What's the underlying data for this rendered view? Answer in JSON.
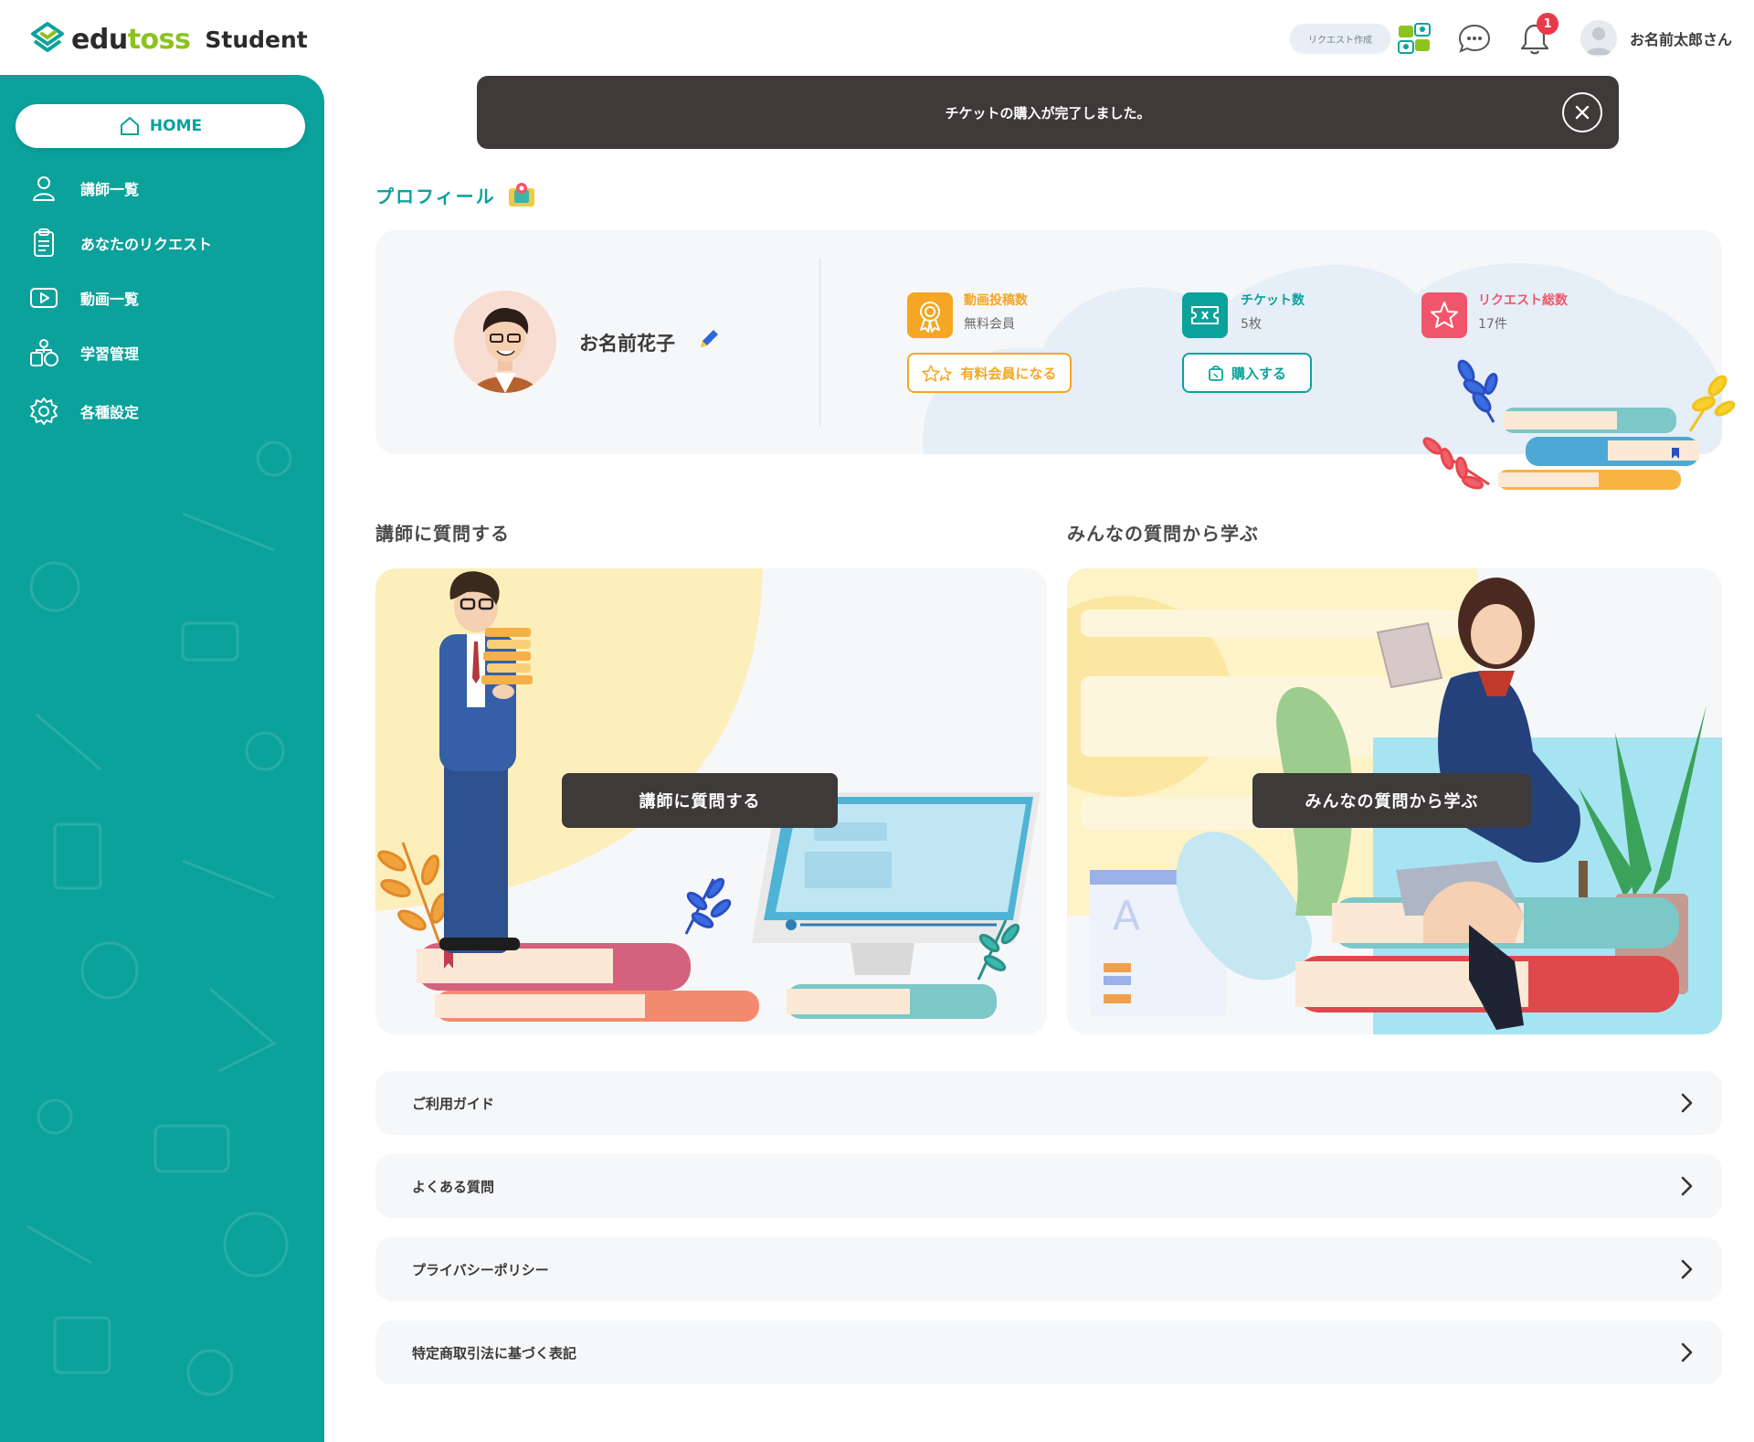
{
  "brand": {
    "name_a": "edu",
    "name_b": "toss",
    "sub": "Student"
  },
  "header": {
    "request_pill": "リクエスト作成",
    "notification_count": "1",
    "user_name": "お名前太郎さん"
  },
  "sidebar": {
    "home_label": "HOME",
    "items": [
      {
        "label": "講師一覧",
        "icon": "person-icon"
      },
      {
        "label": "あなたのリクエスト",
        "icon": "clipboard-icon"
      },
      {
        "label": "動画一覧",
        "icon": "video-icon"
      },
      {
        "label": "学習管理",
        "icon": "learning-icon"
      },
      {
        "label": "各種設定",
        "icon": "gear-icon"
      }
    ]
  },
  "toast": {
    "message": "チケットの購入が完了しました。"
  },
  "profile": {
    "title": "プロフィール",
    "name": "お名前花子",
    "stats": [
      {
        "label": "動画投稿数",
        "value": "無料会員",
        "button": "有料会員になる",
        "color": "#f5a623"
      },
      {
        "label": "チケット数",
        "value": "5枚",
        "button": "購入する",
        "color": "#0ba29b"
      },
      {
        "label": "リクエスト総数",
        "value": "17件",
        "color": "#f0566b"
      }
    ]
  },
  "cards": {
    "ask": {
      "heading": "講師に質問する",
      "button": "講師に質問する"
    },
    "learn": {
      "heading": "みんなの質問から学ぶ",
      "button": "みんなの質問から学ぶ"
    }
  },
  "links": [
    {
      "label": "ご利用ガイド"
    },
    {
      "label": "よくある質問"
    },
    {
      "label": "プライバシーポリシー"
    },
    {
      "label": "特定商取引法に基づく表記"
    }
  ],
  "colors": {
    "primary": "#0ba29b",
    "brand_green": "#8dc21f",
    "dark": "#3d3a39",
    "badge": "#e83a4a"
  }
}
